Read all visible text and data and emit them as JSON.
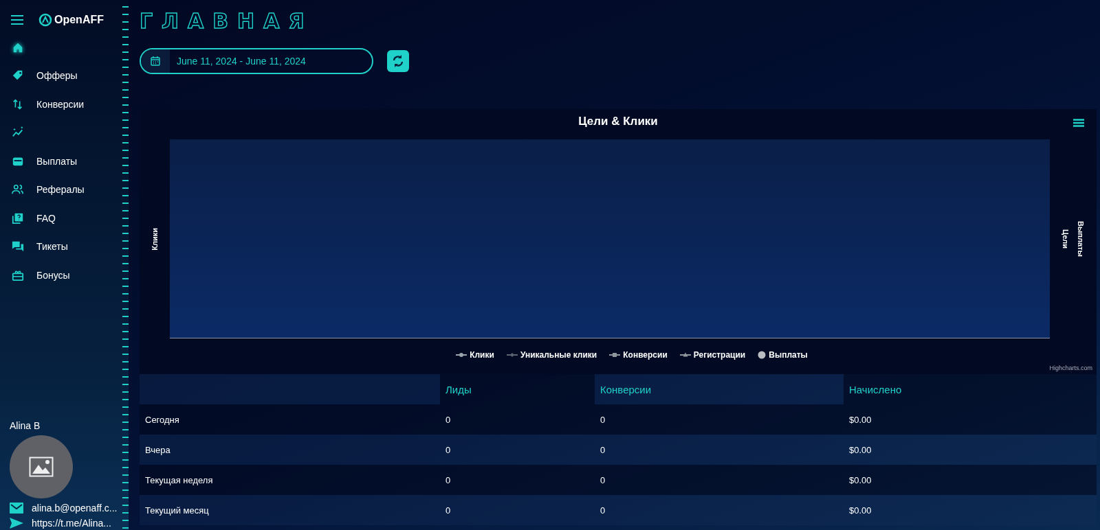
{
  "sidebar": {
    "logo": "OpenAFF",
    "items": [
      {
        "selected": true
      },
      {
        "label": "Офферы",
        "selected": false
      },
      {
        "label": "Конверсии",
        "selected": false
      },
      {
        "selected": false
      },
      {
        "label": "Выплаты",
        "selected": false
      },
      {
        "label": "Рефералы",
        "selected": false
      },
      {
        "label": "FAQ",
        "selected": false
      },
      {
        "label": "Тикеты",
        "selected": false
      },
      {
        "label": "Бонусы",
        "selected": false
      }
    ],
    "user": {
      "name": "Alina B",
      "email": "alina.b@openaff.c...",
      "telegram": "https://t.me/Alina..."
    }
  },
  "page_title": "ГЛАВНАЯ",
  "date_range": {
    "value": "June 11, 2024 - June 11, 2024"
  },
  "chart": {
    "title": "Цели & Клики",
    "y_axis_left": "Клики",
    "y_axis_right": [
      "Цели",
      "Выплаты"
    ],
    "legend": [
      {
        "label": "Клики",
        "kind": "line",
        "color": "#9aa4ad"
      },
      {
        "label": "Уникальные клики",
        "kind": "line",
        "color": "#5b6470"
      },
      {
        "label": "Конверсии",
        "kind": "line",
        "color": "#8f959c"
      },
      {
        "label": "Регистрации",
        "kind": "line",
        "color": "#8f959c"
      },
      {
        "label": "Выплаты",
        "kind": "dot",
        "color": "#b9bcc0"
      }
    ],
    "credits": "Highcharts.com"
  },
  "table": {
    "columns": [
      "Лиды",
      "Конверсии",
      "Начислено"
    ],
    "rows": [
      {
        "label": "Сегодня",
        "values": [
          "0",
          "0",
          "$0.00"
        ]
      },
      {
        "label": "Вчера",
        "values": [
          "0",
          "0",
          "$0.00"
        ]
      },
      {
        "label": "Текущая неделя",
        "values": [
          "0",
          "0",
          "$0.00"
        ]
      },
      {
        "label": "Текущий месяц",
        "values": [
          "0",
          "0",
          "$0.00"
        ]
      }
    ]
  }
}
